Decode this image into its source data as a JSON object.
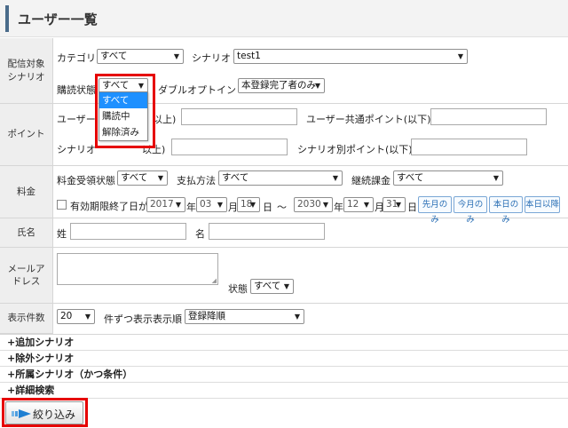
{
  "page": {
    "title": "ユーザー一覧"
  },
  "sections": {
    "scenario": {
      "label": "配信対象\nシナリオ",
      "category_label": "カテゴリ",
      "category_value": "すべて",
      "scenario_label": "シナリオ",
      "scenario_value": "test1",
      "subscription_label": "購読状態",
      "subscription_value": "すべて",
      "subscription_options": [
        "すべて",
        "購読中",
        "解除済み"
      ],
      "double_optin_label": "ダブルオプトイン",
      "double_optin_value": "本登録完了者のみ"
    },
    "points": {
      "label": "ポイント",
      "user_common_min_label": "ユーザー共通ポイント(以上)",
      "user_common_min_visible": "ユーザー",
      "user_common_min_suffix": "以上)",
      "user_common_max_label": "ユーザー共通ポイント(以下)",
      "scenario_min_label": "シナリオ別ポイント(以上)",
      "scenario_min_visible": "シナリオ",
      "scenario_min_suffix": "以上)",
      "scenario_max_label": "シナリオ別ポイント(以下)"
    },
    "fee": {
      "label": "料金",
      "receive_status_label": "料金受領状態",
      "receive_status_value": "すべて",
      "payment_method_label": "支払方法",
      "payment_method_value": "すべて",
      "continuous_label": "継続課金",
      "continuous_value": "すべて",
      "expiry_label": "有効期限終了日が",
      "from_year": "2017",
      "from_month": "03",
      "from_day": "18",
      "to_year": "2030",
      "to_month": "12",
      "to_day": "31",
      "unit_year": "年",
      "unit_month": "月",
      "unit_day": "日",
      "tilde": "～",
      "btn_last_month": "先月のみ",
      "btn_this_month": "今月のみ",
      "btn_today": "本日のみ",
      "btn_after_today": "本日以降"
    },
    "name": {
      "label": "氏名",
      "last_label": "姓",
      "first_label": "名"
    },
    "email": {
      "label": "メールア\nドレス",
      "status_label": "状態",
      "status_value": "すべて"
    },
    "display": {
      "label": "表示件数",
      "count_value": "20",
      "count_suffix": "件ずつ表示",
      "order_label": "表示順",
      "order_value": "登録降順"
    }
  },
  "expanders": [
    "+追加シナリオ",
    "+除外シナリオ",
    "+所属シナリオ（かつ条件）",
    "+詳細検索"
  ],
  "submit_label": "絞り込み",
  "colors": {
    "highlight": "#e60000",
    "selected_option": "#1e90ff",
    "accent": "#4a6b8a"
  }
}
